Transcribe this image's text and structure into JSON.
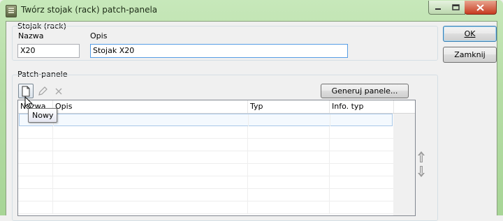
{
  "window": {
    "title": "Twórz stojak (rack) patch-panela",
    "controls": {
      "minimize": "minimize",
      "maximize": "maximize",
      "close": "close"
    }
  },
  "rack_group": {
    "label": "Stojak (rack)",
    "name_label": "Nazwa",
    "name_value": "X20",
    "description_label": "Opis",
    "description_value": "Stojak X20"
  },
  "buttons": {
    "ok": "OK",
    "close": "Zamknij",
    "generate_panels": "Generuj panele..."
  },
  "patch_panels_group": {
    "label": "Patch-panele",
    "tooltip": "Nowy",
    "columns": [
      "Nazwa",
      "Opis",
      "Typ",
      "Info. typ"
    ]
  },
  "icons": {
    "new": "new-document-icon",
    "edit": "pencil-icon",
    "delete": "delete-x-icon",
    "move_up": "arrow-up-icon",
    "move_down": "arrow-down-icon"
  },
  "colors": {
    "title_bar": "#b6dda6",
    "focus_border": "#569de5",
    "selection_border": "#a8c8e8"
  }
}
